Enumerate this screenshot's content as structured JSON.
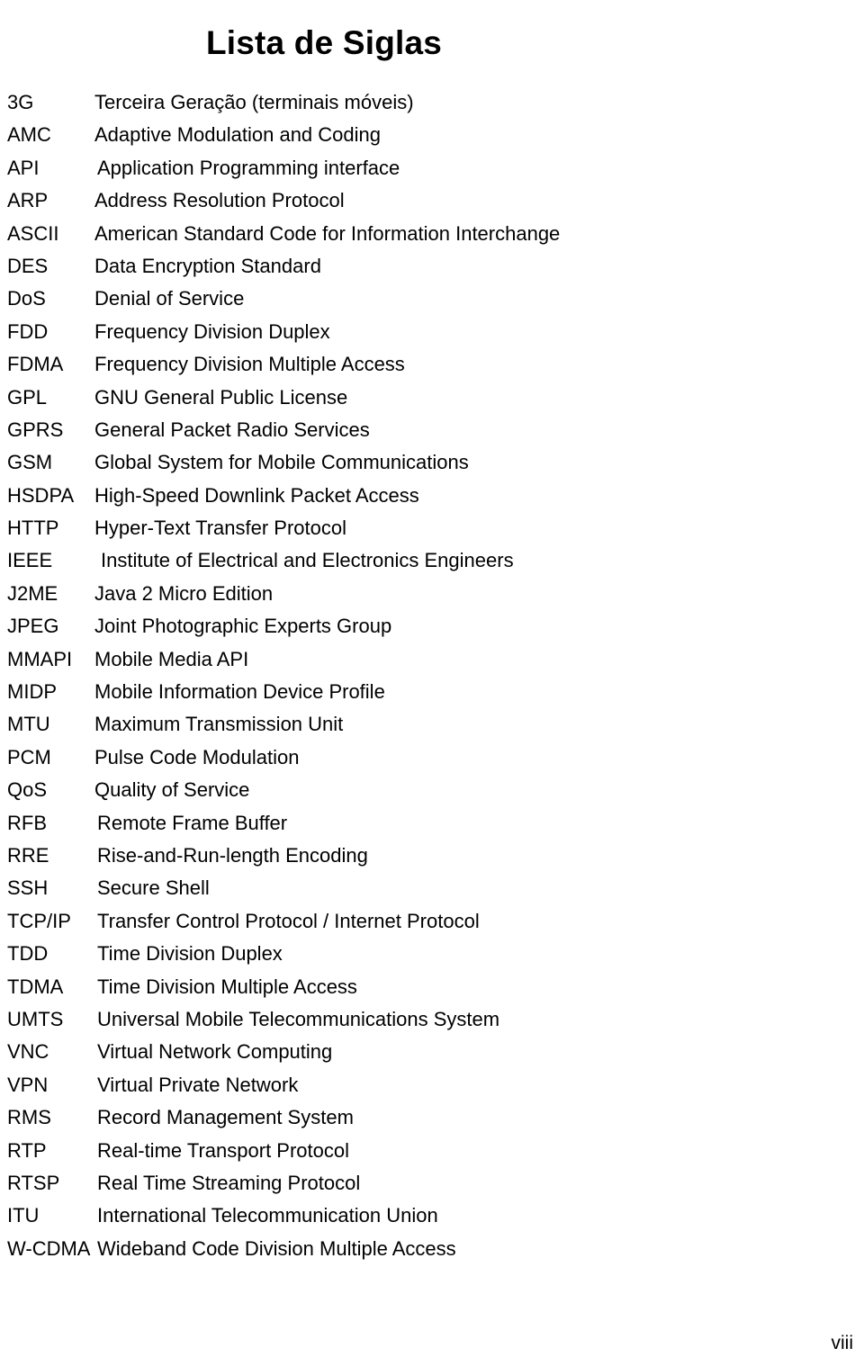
{
  "document": {
    "title": "Lista de Siglas",
    "page_number": "viii"
  },
  "acronyms": [
    {
      "term": "3G",
      "definition": "Terceira Geração (terminais móveis)",
      "indent": 0
    },
    {
      "term": "AMC",
      "definition": "Adaptive Modulation and Coding",
      "indent": 0
    },
    {
      "term": "API",
      "definition": "Application Programming interface",
      "indent": 1
    },
    {
      "term": "ARP",
      "definition": "Address Resolution Protocol",
      "indent": 0
    },
    {
      "term": "ASCII",
      "definition": "American Standard Code for Information Interchange",
      "indent": 0
    },
    {
      "term": "DES",
      "definition": "Data Encryption Standard",
      "indent": 0
    },
    {
      "term": "DoS",
      "definition": "Denial of Service",
      "indent": 0
    },
    {
      "term": "FDD",
      "definition": "Frequency Division Duplex",
      "indent": 0
    },
    {
      "term": "FDMA",
      "definition": "Frequency Division Multiple Access",
      "indent": 0
    },
    {
      "term": "GPL",
      "definition": "GNU General Public License",
      "indent": 0
    },
    {
      "term": "GPRS",
      "definition": "General Packet Radio Services",
      "indent": 0
    },
    {
      "term": "GSM",
      "definition": "Global System for Mobile Communications",
      "indent": 0
    },
    {
      "term": "HSDPA",
      "definition": "High-Speed Downlink Packet Access",
      "indent": 0
    },
    {
      "term": "HTTP",
      "definition": "Hyper-Text Transfer Protocol",
      "indent": 0
    },
    {
      "term": "IEEE",
      "definition": "Institute of Electrical and Electronics Engineers",
      "indent": 2
    },
    {
      "term": "J2ME",
      "definition": "Java 2 Micro Edition",
      "indent": 0
    },
    {
      "term": "JPEG",
      "definition": "Joint Photographic Experts Group",
      "indent": 0
    },
    {
      "term": "MMAPI",
      "definition": "Mobile Media API",
      "indent": 0
    },
    {
      "term": "MIDP",
      "definition": "Mobile Information Device Profile",
      "indent": 0
    },
    {
      "term": "MTU",
      "definition": "Maximum Transmission Unit",
      "indent": 0
    },
    {
      "term": "PCM",
      "definition": "Pulse Code Modulation",
      "indent": 0
    },
    {
      "term": "QoS",
      "definition": "Quality of Service",
      "indent": 0
    },
    {
      "term": "RFB",
      "definition": "Remote Frame Buffer",
      "indent": 1
    },
    {
      "term": "RRE",
      "definition": "Rise-and-Run-length Encoding",
      "indent": 1
    },
    {
      "term": "SSH",
      "definition": "Secure Shell",
      "indent": 1
    },
    {
      "term": "TCP/IP",
      "definition": "Transfer Control Protocol / Internet Protocol",
      "indent": 1
    },
    {
      "term": "TDD",
      "definition": "Time Division Duplex",
      "indent": 1
    },
    {
      "term": "TDMA",
      "definition": "Time Division Multiple Access",
      "indent": 1
    },
    {
      "term": "UMTS",
      "definition": "Universal Mobile Telecommunications System",
      "indent": 1
    },
    {
      "term": "VNC",
      "definition": "Virtual Network Computing",
      "indent": 1
    },
    {
      "term": "VPN",
      "definition": "Virtual Private Network",
      "indent": 1
    },
    {
      "term": "RMS",
      "definition": "Record Management System",
      "indent": 1
    },
    {
      "term": "RTP",
      "definition": "Real-time Transport Protocol",
      "indent": 1
    },
    {
      "term": "RTSP",
      "definition": "Real Time Streaming Protocol",
      "indent": 1
    },
    {
      "term": "ITU",
      "definition": "International Telecommunication Union",
      "indent": 1
    },
    {
      "term": "W-CDMA",
      "definition": "Wideband Code Division Multiple Access",
      "indent": 1
    }
  ]
}
